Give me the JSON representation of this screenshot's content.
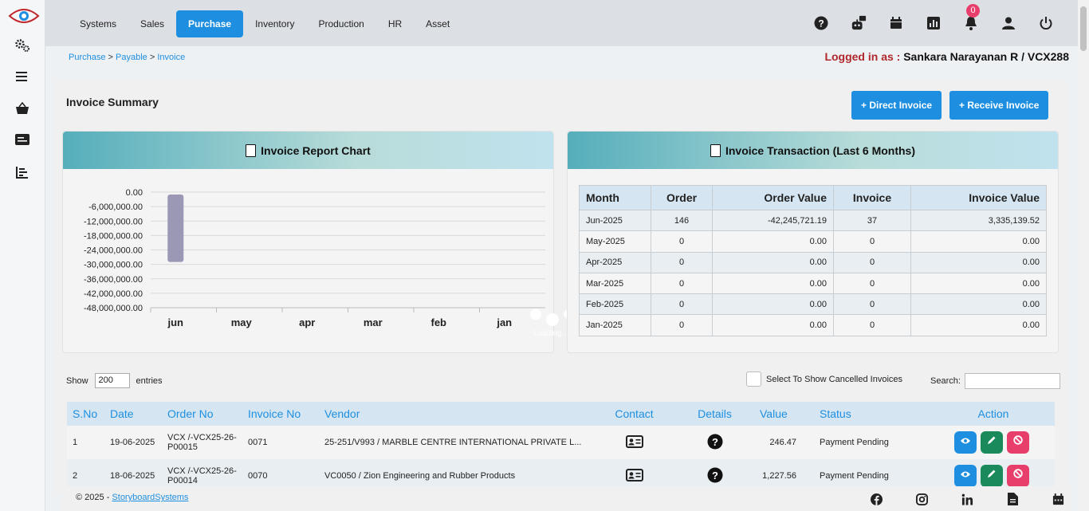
{
  "nav": {
    "tabs": [
      "Systems",
      "Sales",
      "Purchase",
      "Inventory",
      "Production",
      "HR",
      "Asset"
    ],
    "active_tab": "Purchase",
    "notification_count": "0"
  },
  "sidebar": {
    "items": [
      "logo-eye-icon",
      "gears-icon",
      "menu-icon",
      "basket-icon",
      "money-icon",
      "bar-chart-icon"
    ]
  },
  "breadcrumb": {
    "part1": "Purchase",
    "part2": "Payable",
    "part3": "Invoice",
    "sep": ">"
  },
  "login": {
    "label": "Logged in as :",
    "user": "Sankara Narayanan R / VCX288"
  },
  "summary": {
    "title": "Invoice Summary",
    "direct_invoice_label": "+ Direct Invoice",
    "receive_invoice_label": "+ Receive Invoice"
  },
  "chart_panel": {
    "title": "Invoice Report Chart",
    "loading_text": "Loading..."
  },
  "chart_data": {
    "type": "bar",
    "categories": [
      "jun",
      "may",
      "apr",
      "mar",
      "feb",
      "jan"
    ],
    "values": [
      -29000000,
      0,
      0,
      0,
      0,
      0
    ],
    "bar_start": -1000000,
    "ylim": [
      -48000000,
      0
    ],
    "y_ticks": [
      "0.00",
      "-6,000,000.00",
      "-12,000,000.00",
      "-18,000,000.00",
      "-24,000,000.00",
      "-30,000,000.00",
      "-36,000,000.00",
      "-42,000,000.00",
      "-48,000,000.00"
    ],
    "bar_color": "#9a98b5",
    "grid": true
  },
  "transaction_panel": {
    "title": "Invoice Transaction (Last 6 Months)",
    "headers": [
      "Month",
      "Order",
      "Order Value",
      "Invoice",
      "Invoice Value"
    ],
    "rows": [
      [
        "Jun-2025",
        "146",
        "-42,245,721.19",
        "37",
        "3,335,139.52"
      ],
      [
        "May-2025",
        "0",
        "0.00",
        "0",
        "0.00"
      ],
      [
        "Apr-2025",
        "0",
        "0.00",
        "0",
        "0.00"
      ],
      [
        "Mar-2025",
        "0",
        "0.00",
        "0",
        "0.00"
      ],
      [
        "Feb-2025",
        "0",
        "0.00",
        "0",
        "0.00"
      ],
      [
        "Jan-2025",
        "0",
        "0.00",
        "0",
        "0.00"
      ]
    ]
  },
  "controls": {
    "show_label": "Show",
    "entries_value": "200",
    "entries_label": "entries",
    "cancelled_label": "Select To Show Cancelled Invoices",
    "search_label": "Search:",
    "search_value": ""
  },
  "invoices": {
    "headers": [
      "S.No",
      "Date",
      "Order No",
      "Invoice No",
      "Vendor",
      "Contact",
      "Details",
      "Value",
      "Status",
      "Action"
    ],
    "rows": [
      {
        "sno": "1",
        "date": "19-06-2025",
        "order_no": "VCX /-VCX25-26-P00015",
        "invoice_no": "0071",
        "vendor": "25-251/V993 / MARBLE CENTRE INTERNATIONAL PRIVATE L...",
        "value": "246.47",
        "status": "Payment Pending"
      },
      {
        "sno": "2",
        "date": "18-06-2025",
        "order_no": "VCX /-VCX25-26-P00014",
        "invoice_no": "0070",
        "vendor": "VC0050 / Zion Engineering and Rubber Products",
        "value": "1,227.56",
        "status": "Payment Pending"
      }
    ]
  },
  "footer": {
    "copyright": "© 2025 -",
    "company": "StoryboardSystems"
  }
}
